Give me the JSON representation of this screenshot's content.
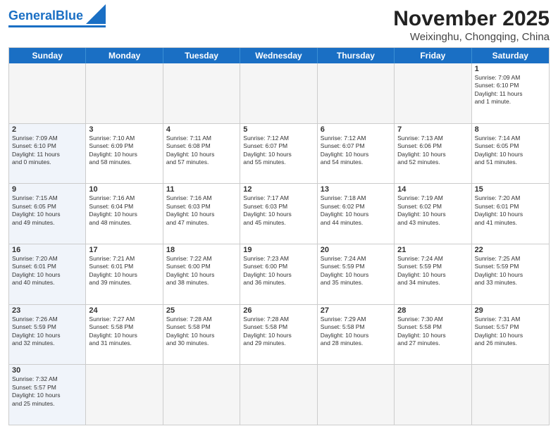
{
  "header": {
    "logo_text_regular": "General",
    "logo_text_blue": "Blue",
    "month": "November 2025",
    "location": "Weixinghu, Chongqing, China"
  },
  "day_headers": [
    "Sunday",
    "Monday",
    "Tuesday",
    "Wednesday",
    "Thursday",
    "Friday",
    "Saturday"
  ],
  "rows": [
    {
      "cells": [
        {
          "empty": true
        },
        {
          "empty": true
        },
        {
          "empty": true
        },
        {
          "empty": true
        },
        {
          "empty": true
        },
        {
          "empty": true
        },
        {
          "day": "1",
          "info": "Sunrise: 7:09 AM\nSunset: 6:10 PM\nDaylight: 11 hours\nand 1 minute."
        }
      ]
    },
    {
      "cells": [
        {
          "day": "2",
          "info": "Sunrise: 7:09 AM\nSunset: 6:10 PM\nDaylight: 11 hours\nand 0 minutes.",
          "sunday": true
        },
        {
          "day": "3",
          "info": "Sunrise: 7:10 AM\nSunset: 6:09 PM\nDaylight: 10 hours\nand 58 minutes."
        },
        {
          "day": "4",
          "info": "Sunrise: 7:11 AM\nSunset: 6:08 PM\nDaylight: 10 hours\nand 57 minutes."
        },
        {
          "day": "5",
          "info": "Sunrise: 7:12 AM\nSunset: 6:07 PM\nDaylight: 10 hours\nand 55 minutes."
        },
        {
          "day": "6",
          "info": "Sunrise: 7:12 AM\nSunset: 6:07 PM\nDaylight: 10 hours\nand 54 minutes."
        },
        {
          "day": "7",
          "info": "Sunrise: 7:13 AM\nSunset: 6:06 PM\nDaylight: 10 hours\nand 52 minutes."
        },
        {
          "day": "8",
          "info": "Sunrise: 7:14 AM\nSunset: 6:05 PM\nDaylight: 10 hours\nand 51 minutes."
        }
      ]
    },
    {
      "cells": [
        {
          "day": "9",
          "info": "Sunrise: 7:15 AM\nSunset: 6:05 PM\nDaylight: 10 hours\nand 49 minutes.",
          "sunday": true
        },
        {
          "day": "10",
          "info": "Sunrise: 7:16 AM\nSunset: 6:04 PM\nDaylight: 10 hours\nand 48 minutes."
        },
        {
          "day": "11",
          "info": "Sunrise: 7:16 AM\nSunset: 6:03 PM\nDaylight: 10 hours\nand 47 minutes."
        },
        {
          "day": "12",
          "info": "Sunrise: 7:17 AM\nSunset: 6:03 PM\nDaylight: 10 hours\nand 45 minutes."
        },
        {
          "day": "13",
          "info": "Sunrise: 7:18 AM\nSunset: 6:02 PM\nDaylight: 10 hours\nand 44 minutes."
        },
        {
          "day": "14",
          "info": "Sunrise: 7:19 AM\nSunset: 6:02 PM\nDaylight: 10 hours\nand 43 minutes."
        },
        {
          "day": "15",
          "info": "Sunrise: 7:20 AM\nSunset: 6:01 PM\nDaylight: 10 hours\nand 41 minutes."
        }
      ]
    },
    {
      "cells": [
        {
          "day": "16",
          "info": "Sunrise: 7:20 AM\nSunset: 6:01 PM\nDaylight: 10 hours\nand 40 minutes.",
          "sunday": true
        },
        {
          "day": "17",
          "info": "Sunrise: 7:21 AM\nSunset: 6:01 PM\nDaylight: 10 hours\nand 39 minutes."
        },
        {
          "day": "18",
          "info": "Sunrise: 7:22 AM\nSunset: 6:00 PM\nDaylight: 10 hours\nand 38 minutes."
        },
        {
          "day": "19",
          "info": "Sunrise: 7:23 AM\nSunset: 6:00 PM\nDaylight: 10 hours\nand 36 minutes."
        },
        {
          "day": "20",
          "info": "Sunrise: 7:24 AM\nSunset: 5:59 PM\nDaylight: 10 hours\nand 35 minutes."
        },
        {
          "day": "21",
          "info": "Sunrise: 7:24 AM\nSunset: 5:59 PM\nDaylight: 10 hours\nand 34 minutes."
        },
        {
          "day": "22",
          "info": "Sunrise: 7:25 AM\nSunset: 5:59 PM\nDaylight: 10 hours\nand 33 minutes."
        }
      ]
    },
    {
      "cells": [
        {
          "day": "23",
          "info": "Sunrise: 7:26 AM\nSunset: 5:59 PM\nDaylight: 10 hours\nand 32 minutes.",
          "sunday": true
        },
        {
          "day": "24",
          "info": "Sunrise: 7:27 AM\nSunset: 5:58 PM\nDaylight: 10 hours\nand 31 minutes."
        },
        {
          "day": "25",
          "info": "Sunrise: 7:28 AM\nSunset: 5:58 PM\nDaylight: 10 hours\nand 30 minutes."
        },
        {
          "day": "26",
          "info": "Sunrise: 7:28 AM\nSunset: 5:58 PM\nDaylight: 10 hours\nand 29 minutes."
        },
        {
          "day": "27",
          "info": "Sunrise: 7:29 AM\nSunset: 5:58 PM\nDaylight: 10 hours\nand 28 minutes."
        },
        {
          "day": "28",
          "info": "Sunrise: 7:30 AM\nSunset: 5:58 PM\nDaylight: 10 hours\nand 27 minutes."
        },
        {
          "day": "29",
          "info": "Sunrise: 7:31 AM\nSunset: 5:57 PM\nDaylight: 10 hours\nand 26 minutes."
        }
      ]
    },
    {
      "cells": [
        {
          "day": "30",
          "info": "Sunrise: 7:32 AM\nSunset: 5:57 PM\nDaylight: 10 hours\nand 25 minutes.",
          "sunday": true
        },
        {
          "empty": true
        },
        {
          "empty": true
        },
        {
          "empty": true
        },
        {
          "empty": true
        },
        {
          "empty": true
        },
        {
          "empty": true
        }
      ]
    }
  ]
}
